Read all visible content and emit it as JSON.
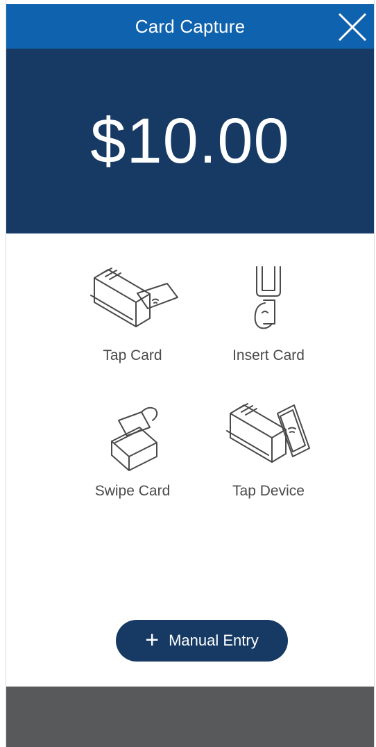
{
  "header": {
    "title": "Card Capture",
    "close_icon": "close-icon"
  },
  "payment": {
    "amount": "$10.00"
  },
  "options": [
    {
      "label": "Tap Card",
      "icon": "tap-card-icon"
    },
    {
      "label": "Insert Card",
      "icon": "insert-card-icon"
    },
    {
      "label": "Swipe Card",
      "icon": "swipe-card-icon"
    },
    {
      "label": "Tap Device",
      "icon": "tap-device-icon"
    }
  ],
  "manual_entry": {
    "label": "Manual Entry",
    "icon": "plus-icon"
  },
  "colors": {
    "header": "#0f62ad",
    "amount_panel": "#163a64",
    "button": "#163a64",
    "footer": "#58595b",
    "label_text": "#4a4a4a"
  }
}
